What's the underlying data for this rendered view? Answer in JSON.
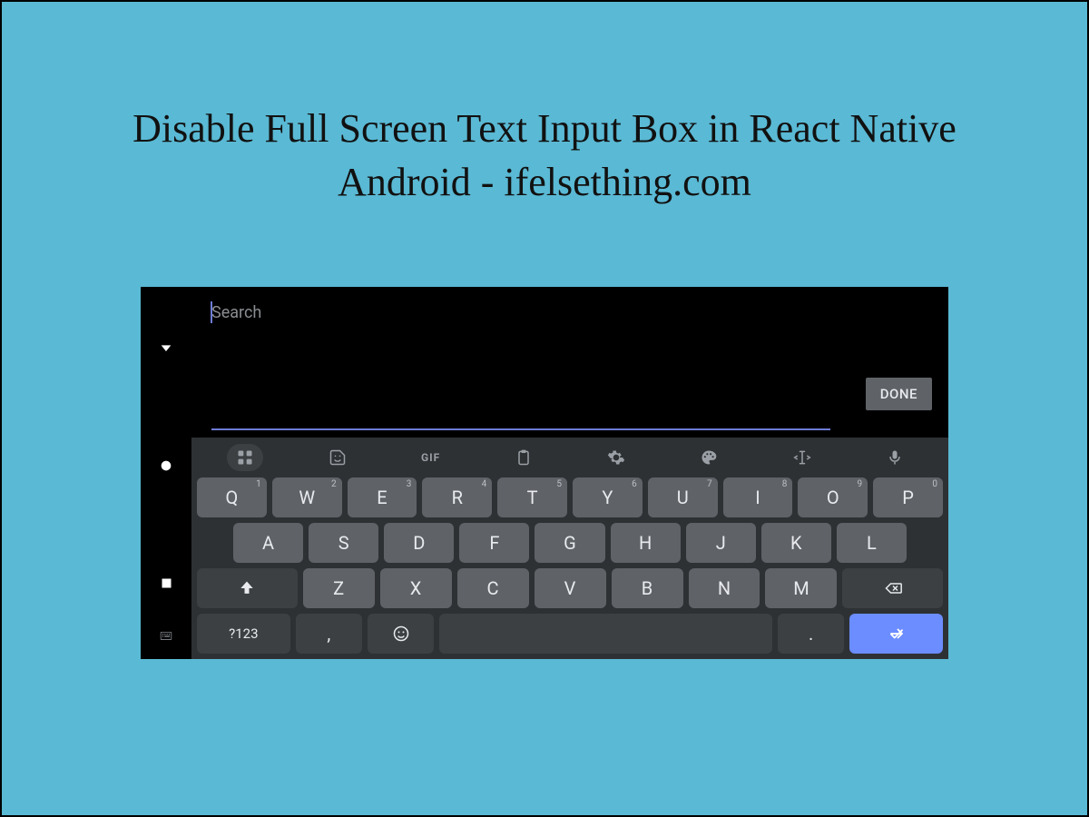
{
  "title": "Disable Full Screen Text Input Box in React Native Android - ifelsething.com",
  "input": {
    "placeholder": "Search",
    "done": "DONE"
  },
  "keyboard": {
    "row1": [
      {
        "k": "Q",
        "s": "1"
      },
      {
        "k": "W",
        "s": "2"
      },
      {
        "k": "E",
        "s": "3"
      },
      {
        "k": "R",
        "s": "4"
      },
      {
        "k": "T",
        "s": "5"
      },
      {
        "k": "Y",
        "s": "6"
      },
      {
        "k": "U",
        "s": "7"
      },
      {
        "k": "I",
        "s": "8"
      },
      {
        "k": "O",
        "s": "9"
      },
      {
        "k": "P",
        "s": "0"
      }
    ],
    "row2": [
      "A",
      "S",
      "D",
      "F",
      "G",
      "H",
      "J",
      "K",
      "L"
    ],
    "row3": [
      "Z",
      "X",
      "C",
      "V",
      "B",
      "N",
      "M"
    ],
    "sym": "?123",
    "comma": ",",
    "period": "."
  }
}
